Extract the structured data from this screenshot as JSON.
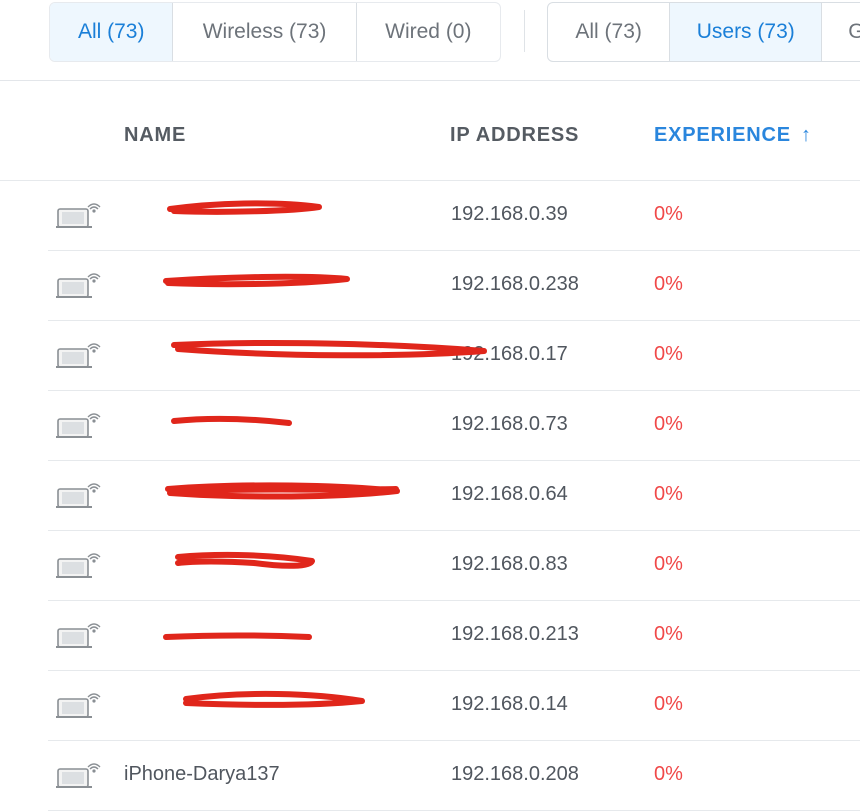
{
  "filters": {
    "connection": [
      {
        "label": "All (73)",
        "active": true
      },
      {
        "label": "Wireless (73)",
        "active": false
      },
      {
        "label": "Wired (0)",
        "active": false
      }
    ],
    "type": [
      {
        "label": "All (73)",
        "active": false
      },
      {
        "label": "Users (73)",
        "active": true
      },
      {
        "label": "G",
        "active": false
      }
    ]
  },
  "table": {
    "headers": {
      "name": "NAME",
      "ip": "IP ADDRESS",
      "experience": "EXPERIENCE",
      "sort_arrow": "↑"
    },
    "rows": [
      {
        "name": "",
        "ip": "192.168.0.39",
        "experience": "0%"
      },
      {
        "name": "",
        "ip": "192.168.0.238",
        "experience": "0%"
      },
      {
        "name": "",
        "ip": "192.168.0.17",
        "experience": "0%"
      },
      {
        "name": "",
        "ip": "192.168.0.73",
        "experience": "0%"
      },
      {
        "name": "",
        "ip": "192.168.0.64",
        "experience": "0%"
      },
      {
        "name": "",
        "ip": "192.168.0.83",
        "experience": "0%"
      },
      {
        "name": "",
        "ip": "192.168.0.213",
        "experience": "0%"
      },
      {
        "name": "",
        "ip": "192.168.0.14",
        "experience": "0%"
      },
      {
        "name": "iPhone-Darya137",
        "ip": "192.168.0.208",
        "experience": "0%"
      }
    ]
  },
  "colors": {
    "accent": "#1a7fd8",
    "bad": "#f04848",
    "redaction": "#e0261b"
  }
}
